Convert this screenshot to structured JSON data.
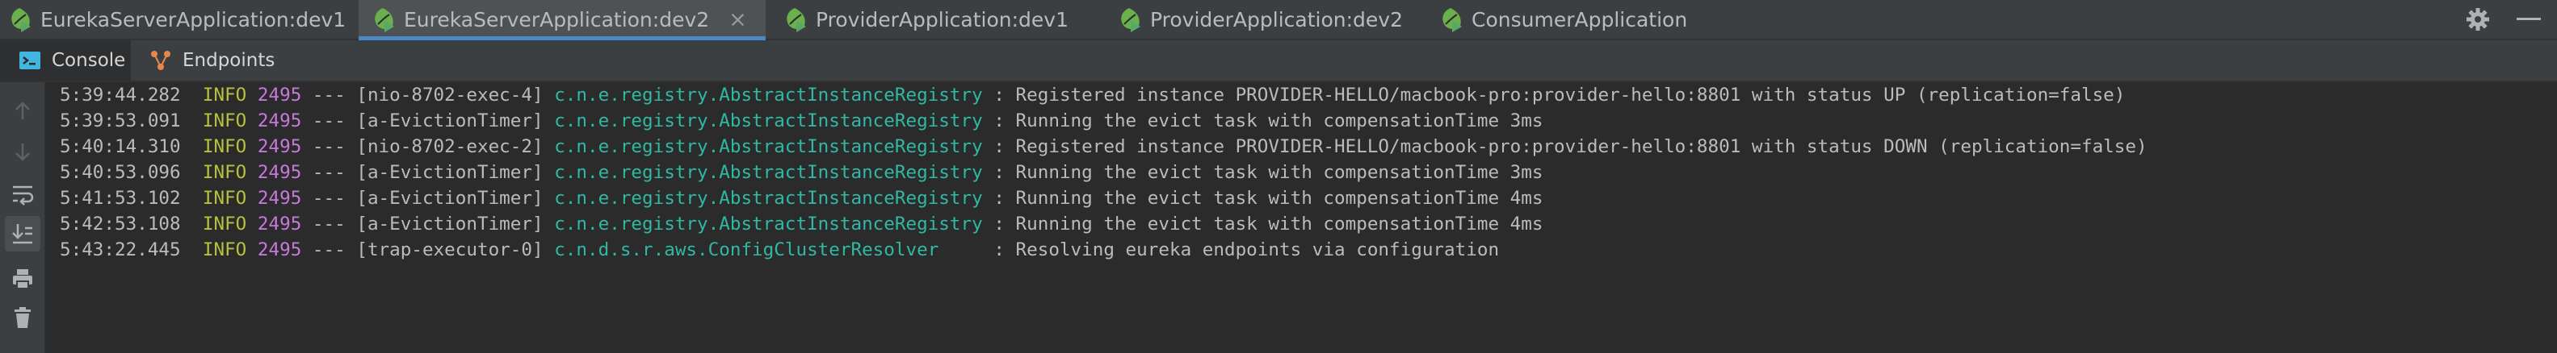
{
  "tabs": [
    {
      "label": "EurekaServerApplication:dev1",
      "active": false,
      "closable": false,
      "icon": "spring-boot-run-icon"
    },
    {
      "label": "EurekaServerApplication:dev2",
      "active": true,
      "closable": true,
      "icon": "spring-boot-run-icon"
    },
    {
      "label": "ProviderApplication:dev1",
      "active": false,
      "closable": false,
      "icon": "spring-boot-run-icon"
    },
    {
      "label": "ProviderApplication:dev2",
      "active": false,
      "closable": false,
      "icon": "spring-boot-run-icon"
    },
    {
      "label": "ConsumerApplication",
      "active": false,
      "closable": false,
      "icon": "spring-boot-run-icon"
    }
  ],
  "tab_close_glyph": "×",
  "subtabs": [
    {
      "label": "Console",
      "active": true,
      "icon": "console-icon"
    },
    {
      "label": "Endpoints",
      "active": false,
      "icon": "endpoints-icon"
    }
  ],
  "toolbar_icons": [
    "scroll-up-icon",
    "scroll-down-icon",
    "soft-wrap-icon",
    "scroll-to-end-icon",
    "print-icon",
    "clear-all-icon"
  ],
  "log": [
    {
      "time": "5:39:44.282",
      "level": "INFO",
      "pid": "2495",
      "sep": "---",
      "thread": "[nio-8702-exec-4]",
      "logger": "c.n.e.registry.AbstractInstanceRegistry ",
      "message": ": Registered instance PROVIDER-HELLO/macbook-pro:provider-hello:8801 with status UP (replication=false)"
    },
    {
      "time": "5:39:53.091",
      "level": "INFO",
      "pid": "2495",
      "sep": "---",
      "thread": "[a-EvictionTimer]",
      "logger": "c.n.e.registry.AbstractInstanceRegistry ",
      "message": ": Running the evict task with compensationTime 3ms"
    },
    {
      "time": "5:40:14.310",
      "level": "INFO",
      "pid": "2495",
      "sep": "---",
      "thread": "[nio-8702-exec-2]",
      "logger": "c.n.e.registry.AbstractInstanceRegistry ",
      "message": ": Registered instance PROVIDER-HELLO/macbook-pro:provider-hello:8801 with status DOWN (replication=false)"
    },
    {
      "time": "5:40:53.096",
      "level": "INFO",
      "pid": "2495",
      "sep": "---",
      "thread": "[a-EvictionTimer]",
      "logger": "c.n.e.registry.AbstractInstanceRegistry ",
      "message": ": Running the evict task with compensationTime 3ms"
    },
    {
      "time": "5:41:53.102",
      "level": "INFO",
      "pid": "2495",
      "sep": "---",
      "thread": "[a-EvictionTimer]",
      "logger": "c.n.e.registry.AbstractInstanceRegistry ",
      "message": ": Running the evict task with compensationTime 4ms"
    },
    {
      "time": "5:42:53.108",
      "level": "INFO",
      "pid": "2495",
      "sep": "---",
      "thread": "[a-EvictionTimer]",
      "logger": "c.n.e.registry.AbstractInstanceRegistry ",
      "message": ": Running the evict task with compensationTime 4ms"
    },
    {
      "time": "5:43:22.445",
      "level": "INFO",
      "pid": "2495",
      "sep": "---",
      "thread": "[trap-executor-0]",
      "logger": "c.n.d.s.r.aws.ConfigClusterResolver     ",
      "message": ": Resolving eureka endpoints via configuration"
    }
  ],
  "colors": {
    "background": "#2b2b2b",
    "panel": "#3c3f41",
    "active_tab_underline": "#4a88c7",
    "info_level": "#b4c23f",
    "pid": "#c678dd",
    "logger": "#2fb9a4",
    "text": "#bbbbbb"
  }
}
